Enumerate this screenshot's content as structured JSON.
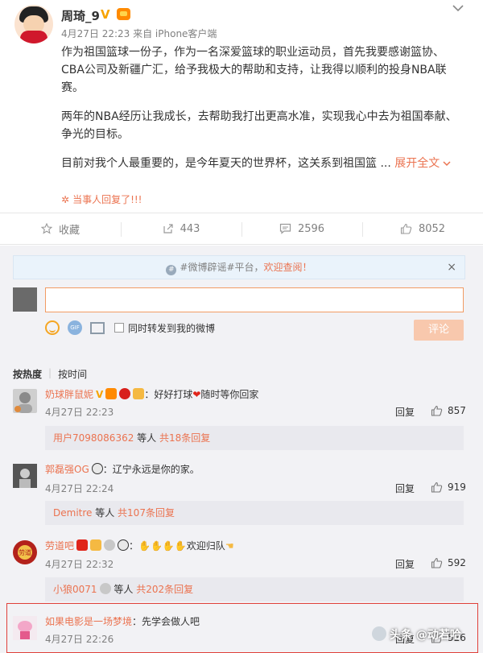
{
  "post": {
    "author": "周琦_9",
    "meta": "4月27日 22:23 来自 iPhone客户端",
    "paragraphs": [
      "作为祖国篮球一份子，作为一名深爱篮球的职业运动员，首先我要感谢篮协、CBA公司及新疆广汇，给予我极大的帮助和支持，让我得以顺利的投身NBA联赛。",
      "两年的NBA经历让我成长，去帮助我打出更高水准，实现我心中去为祖国奉献、争光的目标。",
      "目前对我个人最重要的，是今年夏天的世界杯，这关系到祖国篮 ..."
    ],
    "expand_label": "展开全文",
    "party_label": "当事人回复了!!!"
  },
  "actions": [
    {
      "icon": "star-icon",
      "label": "收藏"
    },
    {
      "icon": "share-icon",
      "label": "443"
    },
    {
      "icon": "comment-icon",
      "label": "2596"
    },
    {
      "icon": "thumbs-up-icon",
      "label": "8052"
    }
  ],
  "notice": {
    "prefix": "#微博辟谣#平台，",
    "link": "欢迎查阅！",
    "close": "×"
  },
  "composer": {
    "input_value": "",
    "repost_label": "同时转发到我的微博",
    "submit_label": "评论"
  },
  "sort": {
    "hot": "按热度",
    "time": "按时间"
  },
  "comments": [
    {
      "user": "奶球胖鼠妮",
      "text": "：好好打球",
      "text2": "随时等你回家",
      "date": "4月27日 22:23",
      "reply": "回复",
      "likes": "857",
      "sub_user": "用户7098086362",
      "sub_mid": " 等人 ",
      "sub_count": "共18条回复"
    },
    {
      "user": "郭磊强OG",
      "text": "：辽宁永远是你的家。",
      "date": "4月27日 22:24",
      "reply": "回复",
      "likes": "919",
      "sub_user": "Demitre",
      "sub_mid": " 等人 ",
      "sub_count": "共107条回复"
    },
    {
      "user": "劳道吧",
      "text": "：",
      "text2": "欢迎归队",
      "date": "4月27日 22:32",
      "reply": "回复",
      "likes": "592",
      "sub_user": "小狼0071",
      "sub_mid": " 等人 ",
      "sub_count": "共202条回复"
    },
    {
      "user": "如果电影是一场梦境",
      "text": "：先学会做人吧",
      "date": "4月27日 22:26",
      "reply": "回复",
      "likes": "526"
    }
  ],
  "watermark": "头条 @动若哈",
  "colors": {
    "accent": "#eb7350",
    "highlight_border": "#e0403a",
    "submit_bg": "#f8c8ad"
  }
}
